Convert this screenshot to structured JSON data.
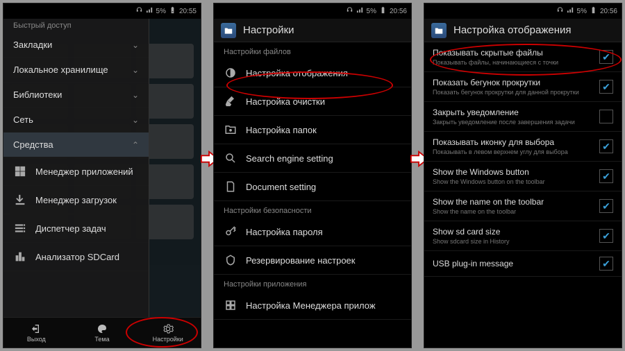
{
  "status": {
    "battery": "5%",
    "time1": "20:55",
    "time2": "20:56",
    "time3": "20:56"
  },
  "panel1": {
    "quick": "Быстрый доступ",
    "items": [
      "Закладки",
      "Локальное хранилище",
      "Библиотеки",
      "Сеть",
      "Средства"
    ],
    "tools": [
      "Менеджер приложений",
      "Менеджер загрузок",
      "Диспетчер задач",
      "Анализатор SDCard"
    ],
    "bottom": {
      "exit": "Выход",
      "theme": "Тема",
      "settings": "Настройки"
    }
  },
  "panel2": {
    "title": "Настройки",
    "sec1": "Настройки файлов",
    "items1": [
      "Настройка отображения",
      "Настройка очистки",
      "Настройка папок",
      "Search engine setting",
      "Document setting"
    ],
    "sec2": "Настройки безопасности",
    "items2": [
      "Настройка пароля",
      "Резервирование настроек"
    ],
    "sec3": "Настройки приложения",
    "items3": [
      "Настройка Менеджера прилож"
    ]
  },
  "panel3": {
    "title": "Настройка отображения",
    "items": [
      {
        "label": "Показывать скрытые файлы",
        "sub": "Показывать файлы, начинающиеся с точки",
        "checked": true
      },
      {
        "label": "Показать бегунок прокрутки",
        "sub": "Показать бегунок прокрутки для данной прокрутки",
        "checked": true
      },
      {
        "label": "Закрыть уведомление",
        "sub": "Закрыть уведомление после завершения задачи",
        "checked": false
      },
      {
        "label": "Показывать иконку для выбора",
        "sub": "Показывать в левом верхнем углу для выбора",
        "checked": true
      },
      {
        "label": "Show the Windows button",
        "sub": "Show the Windows button on the toolbar",
        "checked": true
      },
      {
        "label": "Show the name on the toolbar",
        "sub": "Show the name on the toolbar",
        "checked": true
      },
      {
        "label": "Show sd card size",
        "sub": "Show sdcard size in History",
        "checked": true
      },
      {
        "label": "USB plug-in message",
        "sub": "",
        "checked": true
      }
    ]
  }
}
